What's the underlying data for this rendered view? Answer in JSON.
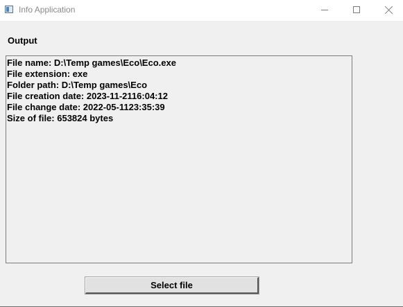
{
  "window": {
    "title": "Info Application"
  },
  "output": {
    "label": "Output",
    "lines": [
      "File name: D:\\Temp games\\Eco\\Eco.exe",
      "File extension: exe",
      "Folder path: D:\\Temp games\\Eco",
      "File creation date: 2023-11-2116:04:12",
      "File change date: 2022-05-1123:35:39",
      "Size of file: 653824 bytes"
    ]
  },
  "actions": {
    "select_file_label": "Select file"
  },
  "icons": {
    "app": "app-window-icon",
    "minimize": "minimize-icon",
    "maximize": "maximize-icon",
    "close": "close-icon"
  }
}
